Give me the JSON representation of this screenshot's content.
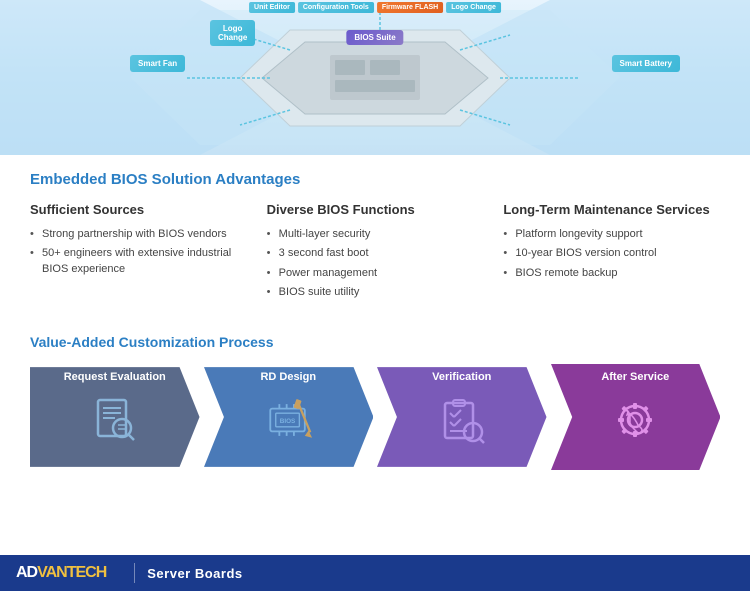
{
  "top_diagram": {
    "labels_top": [
      "Unit Editor",
      "Configuration Tools",
      "Firmware FLASH",
      "Logo Change"
    ],
    "bios_suite": "BIOS Suite",
    "side_labels": [
      "Smart Fan",
      "Logo\nChange",
      "Smart Battery"
    ]
  },
  "section_title": "Embedded BIOS Solution Advantages",
  "columns": [
    {
      "id": "sufficient-sources",
      "title": "Sufficient Sources",
      "bullets": [
        "Strong partnership with BIOS vendors",
        "50+ engineers with extensive industrial BIOS experience"
      ]
    },
    {
      "id": "diverse-bios",
      "title": "Diverse BIOS Functions",
      "bullets": [
        "Multi-layer security",
        "3 second fast boot",
        "Power management",
        "BIOS suite utility"
      ]
    },
    {
      "id": "longterm",
      "title": "Long-Term Maintenance Services",
      "bullets": [
        "Platform longevity support",
        "10-year BIOS version control",
        "BIOS remote backup"
      ]
    }
  ],
  "process": {
    "title": "Value-Added Customization Process",
    "steps": [
      {
        "id": "request",
        "label": "Request Evaluation",
        "color": "#5a6a8a"
      },
      {
        "id": "rd",
        "label": "RD Design",
        "color": "#4a7ab8"
      },
      {
        "id": "verify",
        "label": "Verification",
        "color": "#7a5ab8"
      },
      {
        "id": "after",
        "label": "After Service",
        "color": "#8a3a9a"
      }
    ]
  },
  "footer": {
    "logo_ad": "AD",
    "logo_van": "VANTECH",
    "tagline": "Server Boards"
  }
}
